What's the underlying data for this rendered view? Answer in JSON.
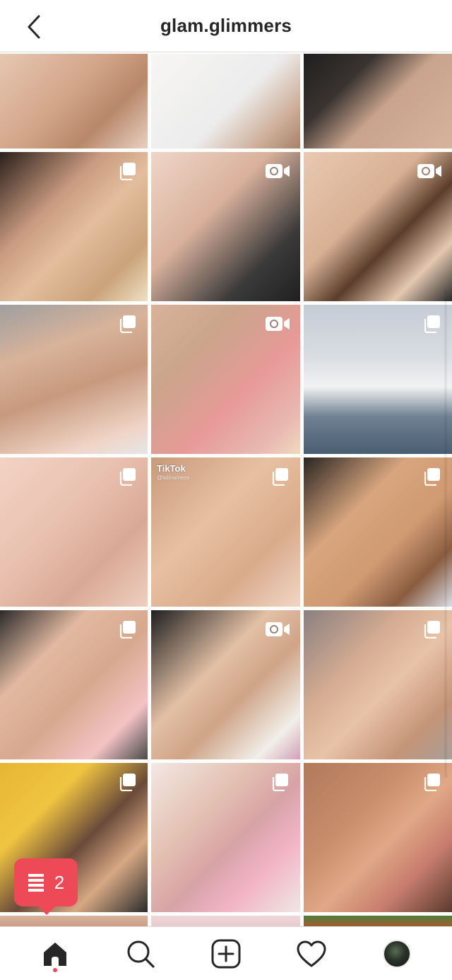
{
  "header": {
    "title": "glam.glimmers"
  },
  "grid": {
    "tiles": [
      {
        "type": "photo",
        "bg": "linear-gradient(135deg,#e7c7b2 0%,#d2a589 45%,#b9876a 70%,#e8d1c2 100%)"
      },
      {
        "type": "photo",
        "bg": "linear-gradient(135deg,#f7f6f5 0%,#ececec 55%,#cfb19c 80%,#a88066 100%)"
      },
      {
        "type": "photo",
        "bg": "linear-gradient(135deg,#1e1e1e 0%,#3a3431 30%,#c9a38c 55%,#d7b39c 100%)"
      },
      {
        "type": "carousel",
        "bg": "linear-gradient(135deg,#2a1f1a 0%,#c99b80 35%,#e3be9e 55%,#caa37a 80%,#efe0c4 100%)"
      },
      {
        "type": "video",
        "bg": "linear-gradient(135deg,#efd6c9 0%,#d9b19c 40%,#3a3a3a 75%,#202020 100%)"
      },
      {
        "type": "video",
        "bg": "linear-gradient(135deg,#e9c9b0 0%,#d8b094 40%,#5a3d2b 60%,#e5c8b0 80%,#2a2a2a 100%)"
      },
      {
        "type": "carousel",
        "bg": "linear-gradient(160deg,#9f9f9f 0%,#d8b39a 30%,#c79a7e 55%,#f0d4c6 85%,#e6e6e6 100%)"
      },
      {
        "type": "video",
        "bg": "linear-gradient(135deg,#d8b29a 0%,#caa58a 30%,#e79a98 60%,#e8b8b0 85%,#f1d9c0 100%)"
      },
      {
        "type": "carousel",
        "bg": "linear-gradient(180deg,#c5ccd6 0%,#d9dde2 35%,#f2f2f3 55%,#6f8193 75%,#4a5e72 100%)"
      },
      {
        "type": "carousel",
        "bg": "linear-gradient(135deg,#f3d3c4 0%,#e9c1b0 40%,#d8a995 70%,#f0cfc0 100%)"
      },
      {
        "type": "carousel",
        "tiktok": true,
        "bg": "linear-gradient(135deg,#c99a7c 0%,#e7c0a2 40%,#d9ab8b 70%,#f0d6c6 100%)"
      },
      {
        "type": "carousel",
        "bg": "linear-gradient(135deg,#2a2522 0%,#d8a57e 35%,#cf9a72 60%,#8a5c40 80%,#d9dde8 100%)"
      },
      {
        "type": "carousel",
        "bg": "linear-gradient(135deg,#2b2b2b 0%,#e2b9a0 30%,#d6a98e 55%,#f3c3c4 80%,#4a4a4a 100%)"
      },
      {
        "type": "video",
        "bg": "linear-gradient(135deg,#1f1f1f 0%,#e3c0a5 40%,#cfa487 60%,#f2efe9 85%,#d2a0b8 100%)"
      },
      {
        "type": "carousel",
        "bg": "linear-gradient(135deg,#8a8080 0%,#d6ad92 35%,#e8c3a8 55%,#c49478 80%,#a99f99 100%)"
      },
      {
        "type": "carousel",
        "bg": "linear-gradient(135deg,#e6b535 0%,#f0c440 30%,#6a4a3a 55%,#d7a883 75%,#2c2c2c 100%)"
      },
      {
        "type": "carousel",
        "bg": "linear-gradient(135deg,#f2e8e4 0%,#e3bfb0 35%,#d7a3a6 55%,#f2b5c7 75%,#efe7e3 100%)"
      },
      {
        "type": "carousel",
        "bg": "linear-gradient(135deg,#b07a5a 0%,#c98e6c 35%,#e0a886 55%,#c77d6e 75%,#5a3a2e 100%)"
      },
      {
        "type": "photo",
        "bg": "linear-gradient(180deg,#d8b39d 0%,#c4957c 100%)"
      },
      {
        "type": "photo",
        "bg": "linear-gradient(180deg,#f0d6d8 0%,#e6c7c9 100%)"
      },
      {
        "type": "photo",
        "bg": "linear-gradient(180deg,#4f7d3a 0%,#c94d2d 100%)"
      }
    ],
    "tiktok_label": "TikTok",
    "tiktok_handle": "@latinamess"
  },
  "toast": {
    "count": "2",
    "color": "#ed4956"
  },
  "nav": {
    "items": [
      "home-icon",
      "search-icon",
      "new-post-icon",
      "activity-heart-icon",
      "profile-avatar"
    ],
    "active": "home",
    "dot_color": "#ed4956"
  }
}
